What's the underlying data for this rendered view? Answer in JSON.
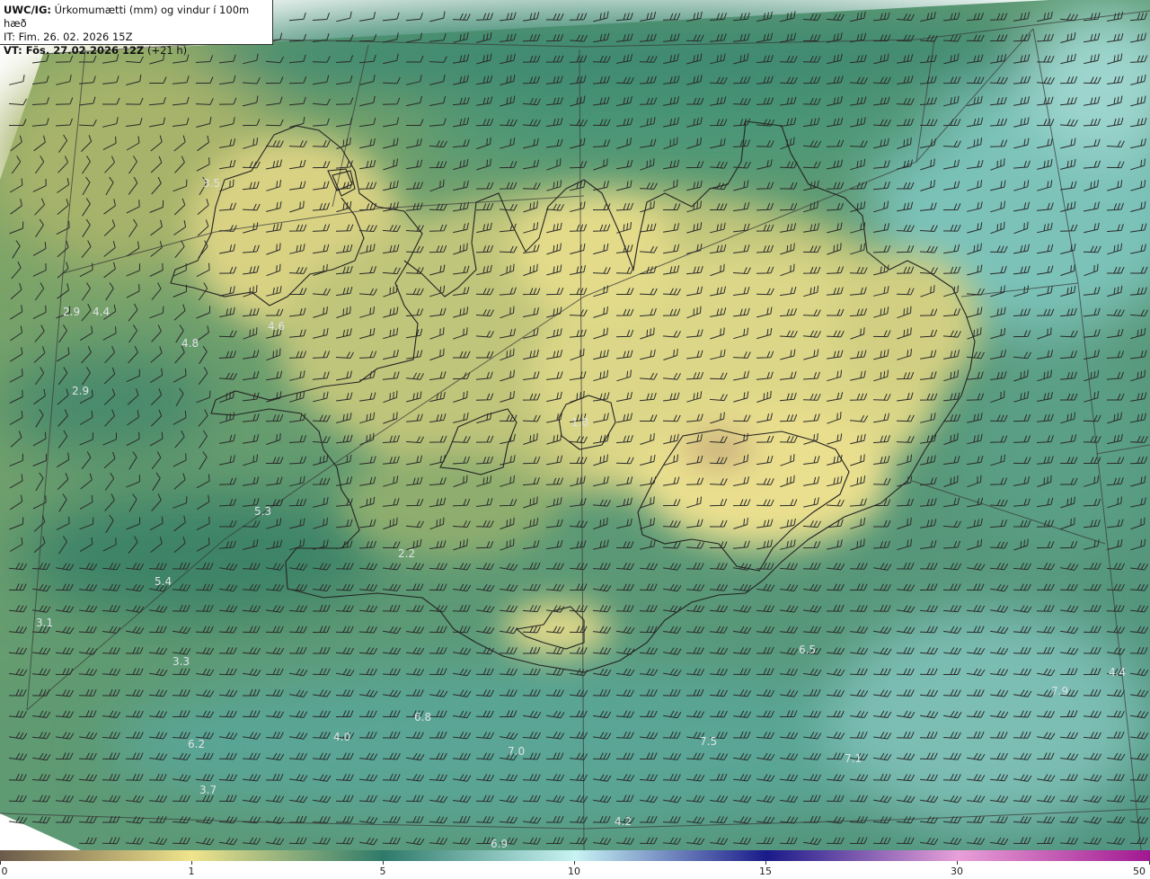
{
  "header": {
    "model_label": "UWC/IG:",
    "title": "Úrkomumætti (mm) og vindur í 100m hæð",
    "it_line": "IT: Fim. 26. 02. 2026 15Z",
    "vt_label": "VT: Fös. 27.02.2026 12Z",
    "vt_offset": "(+21 h)"
  },
  "colorbar": {
    "ticks": [
      "0",
      "1",
      "5",
      "10",
      "15",
      "30",
      "50"
    ],
    "stops": [
      {
        "value": 0,
        "color": "#6b5a4a"
      },
      {
        "value": 1,
        "color": "#f0e48c"
      },
      {
        "value": 5,
        "color": "#2e7a6a"
      },
      {
        "value": 10,
        "color": "#c8f4f4"
      },
      {
        "value": 15,
        "color": "#1a1a8a"
      },
      {
        "value": 30,
        "color": "#e8a0d8"
      },
      {
        "value": 50,
        "color": "#a01890"
      }
    ]
  },
  "labels": [
    {
      "text": "3.5"
    },
    {
      "text": "2.9"
    },
    {
      "text": "4.4"
    },
    {
      "text": "4.8"
    },
    {
      "text": "4.6"
    },
    {
      "text": "2.9"
    },
    {
      "text": "5.3"
    },
    {
      "text": "5.4"
    },
    {
      "text": "3.1"
    },
    {
      "text": "3.3"
    },
    {
      "text": "6.2"
    },
    {
      "text": "3.7"
    },
    {
      "text": "4.0"
    },
    {
      "text": "6.8"
    },
    {
      "text": "7.0"
    },
    {
      "text": "7.5"
    },
    {
      "text": "7.1"
    },
    {
      "text": "6.5"
    },
    {
      "text": "7.9"
    },
    {
      "text": "4.4"
    },
    {
      "text": "4.2"
    },
    {
      "text": "6.9"
    },
    {
      "text": "1.0"
    },
    {
      "text": "2.2"
    }
  ]
}
